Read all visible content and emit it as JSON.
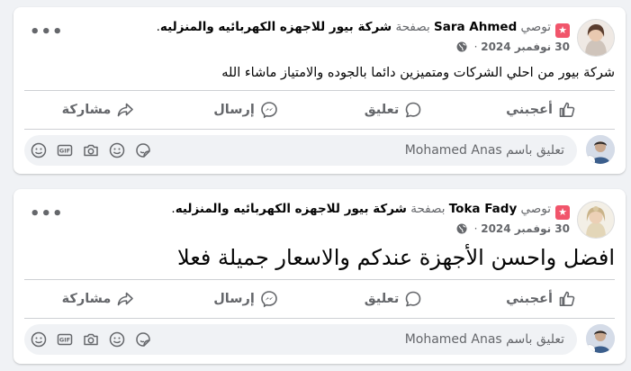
{
  "colors": {
    "accent_badge": "#f1556b",
    "secondary_text": "#65676b",
    "divider": "#ced0d4",
    "bg": "#f0f2f5"
  },
  "posts": [
    {
      "author": "Sara Ahmed",
      "verb": "توصي",
      "at_page": "بصفحة",
      "page_name": "شركة بيور للاجهزه الكهربائيه والمنزليه",
      "period": ".",
      "date": "30 نوفمبر 2024",
      "dot": "·",
      "body": "شركة بيور من احلي الشركات ومتميزين دائما بالجوده والامتياز ماشاء الله",
      "more": "•••",
      "actions": {
        "like": "أعجبني",
        "comment": "تعليق",
        "send": "إرسال",
        "share": "مشاركة"
      },
      "comment_placeholder": "تعليق باسم Mohamed Anas"
    },
    {
      "author": "Toka Fady",
      "verb": "توصي",
      "at_page": "بصفحة",
      "page_name": "شركة بيور للاجهزه الكهربائيه والمنزليه",
      "period": ".",
      "date": "30 نوفمبر 2024",
      "dot": "·",
      "body": "افضل واحسن الأجهزة عندكم والاسعار جميلة فعلا",
      "more": "•••",
      "actions": {
        "like": "أعجبني",
        "comment": "تعليق",
        "send": "إرسال",
        "share": "مشاركة"
      },
      "comment_placeholder": "تعليق باسم Mohamed Anas"
    }
  ],
  "icons": {
    "badge": "recommend-badge-icon",
    "globe": "globe-icon",
    "like": "thumbs-up-icon",
    "comment": "comment-bubble-icon",
    "send": "messenger-icon",
    "share": "share-arrow-icon",
    "comment_tools": [
      "avatar-sticker-icon",
      "emoji-icon",
      "camera-icon",
      "gif-icon",
      "sticker-icon"
    ]
  }
}
